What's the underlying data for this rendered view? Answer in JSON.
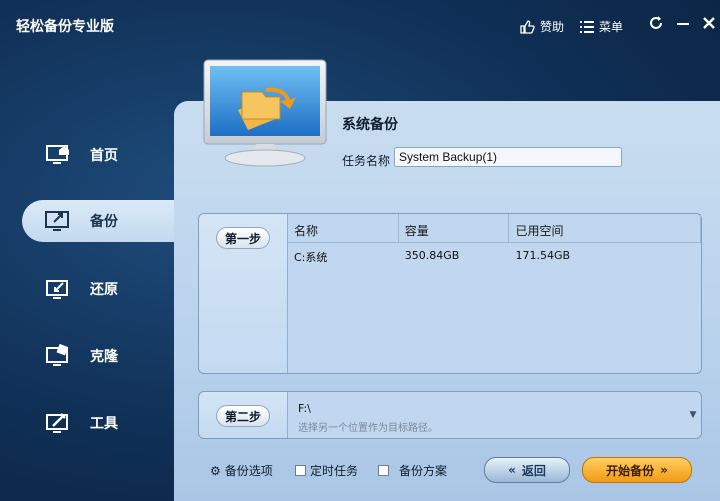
{
  "app": {
    "title": "轻松备份专业版",
    "donate_label": "赞助",
    "menu_label": "菜单",
    "icons": {
      "donate": "thumbs-up-icon",
      "menu": "menu-icon",
      "refresh": "refresh-icon",
      "minimize": "minimize-icon",
      "close": "close-icon"
    }
  },
  "sidebar": {
    "items": [
      {
        "label": "首页",
        "icon": "home-monitor-icon",
        "active": false
      },
      {
        "label": "备份",
        "icon": "backup-monitor-icon",
        "active": true
      },
      {
        "label": "还原",
        "icon": "restore-monitor-icon",
        "active": false
      },
      {
        "label": "克隆",
        "icon": "clone-monitor-icon",
        "active": false
      },
      {
        "label": "工具",
        "icon": "tools-monitor-icon",
        "active": false
      }
    ]
  },
  "main": {
    "section_title": "系统备份",
    "task_name_label": "任务名称",
    "task_name_value": "System Backup(1)",
    "step1": {
      "button_label": "第一步",
      "columns": [
        "名称",
        "容量",
        "已用空间"
      ],
      "rows": [
        {
          "name": "C:系统",
          "capacity": "350.84GB",
          "used": "171.54GB"
        }
      ]
    },
    "step2": {
      "button_label": "第二步",
      "path": "F:\\",
      "hint": "选择另一个位置作为目标路径。"
    },
    "options": {
      "backup_options_label": "备份选项",
      "scheduled_task_label": "定时任务",
      "backup_scheme_label": "备份方案"
    },
    "buttons": {
      "back_label": "返回",
      "start_label": "开始备份"
    }
  },
  "colors": {
    "background": "#0f2f55",
    "panel": "#c9ddf0",
    "accent_orange": "#f29a14"
  }
}
